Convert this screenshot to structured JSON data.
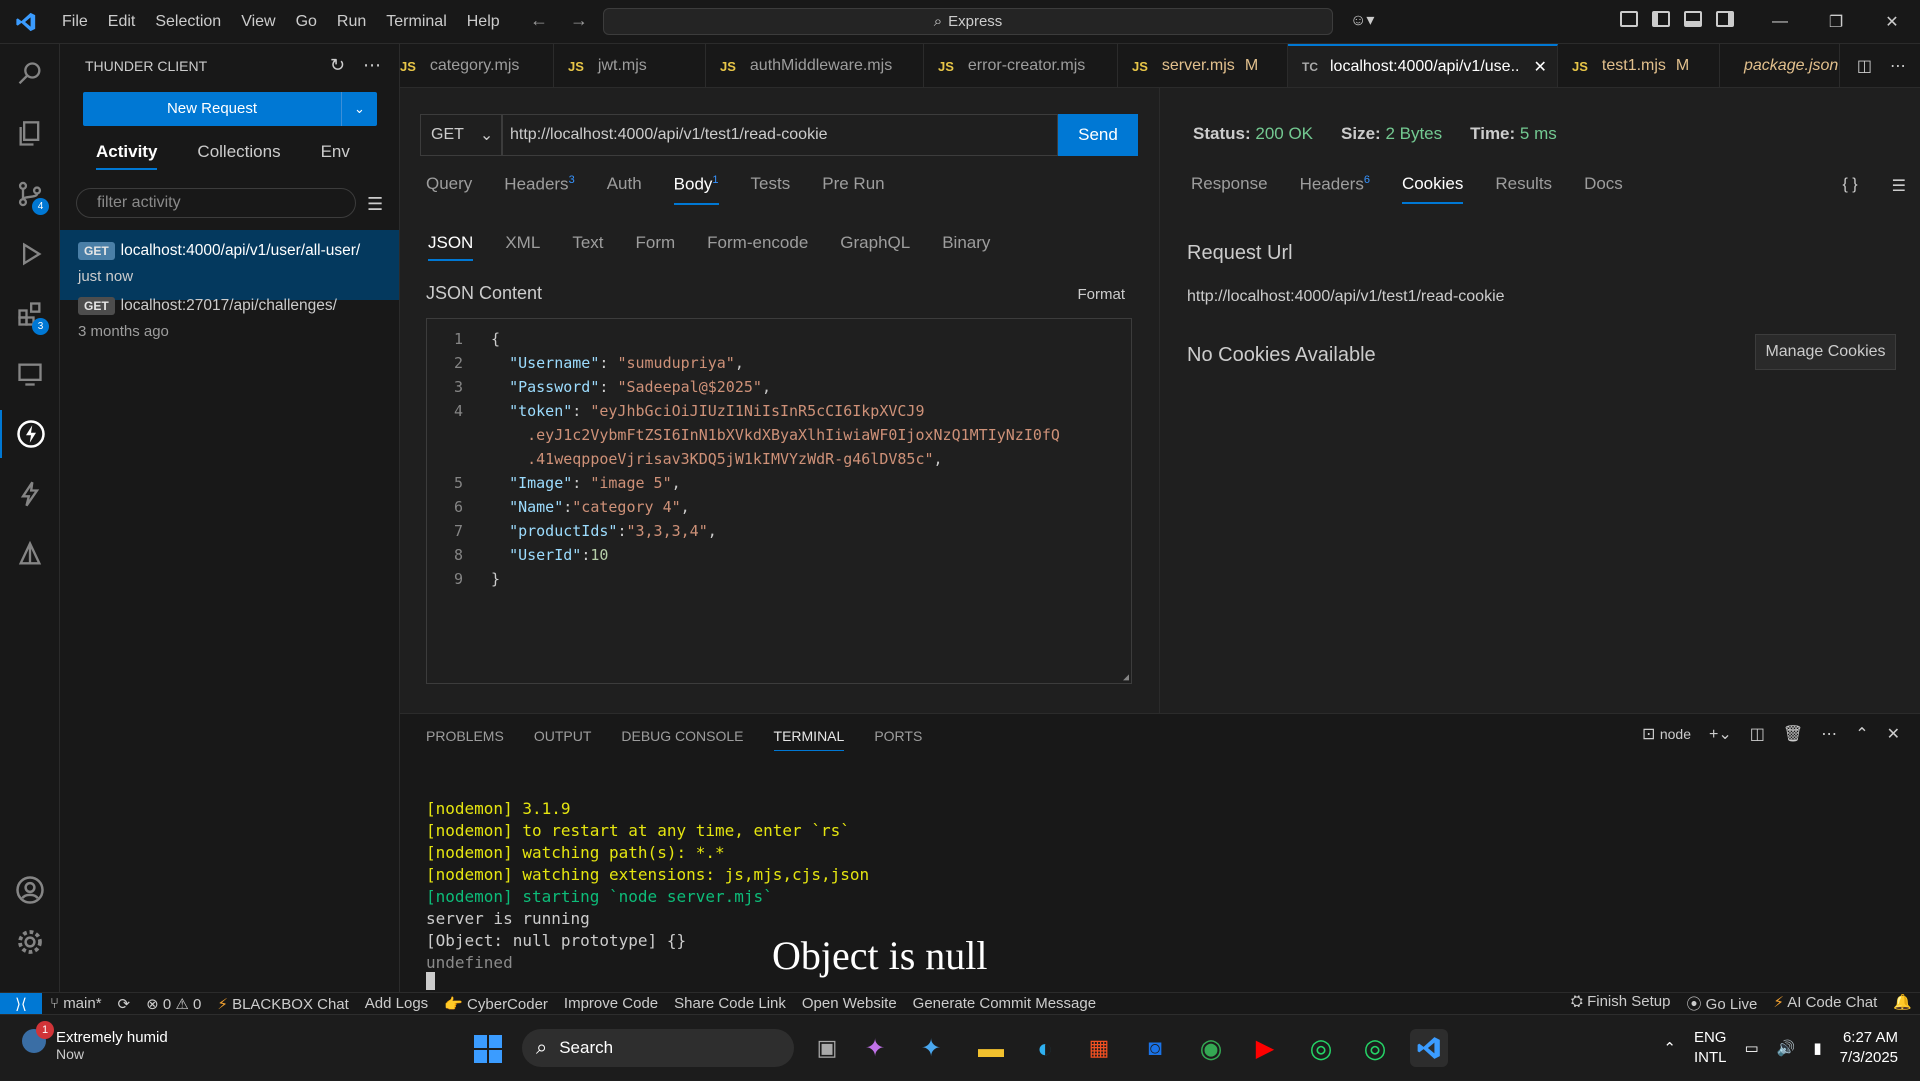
{
  "menu": [
    "File",
    "Edit",
    "Selection",
    "View",
    "Go",
    "Run",
    "Terminal",
    "Help"
  ],
  "command_center": "Express",
  "sidebar": {
    "title": "THUNDER CLIENT",
    "new_request": "New Request",
    "tabs": [
      "Activity",
      "Collections",
      "Env"
    ],
    "filter_placeholder": "filter activity",
    "items": [
      {
        "method": "GET",
        "url": "localhost:4000/api/v1/user/all-user/",
        "time": "just now"
      },
      {
        "method": "GET",
        "url": "localhost:27017/api/challenges/",
        "time": "3 months ago"
      }
    ]
  },
  "activity_badges": {
    "source_control": "4",
    "extensions": "3"
  },
  "tabs": [
    {
      "icon": "JS",
      "label": "category.mjs"
    },
    {
      "icon": "JS",
      "label": "jwt.mjs"
    },
    {
      "icon": "JS",
      "label": "authMiddleware.mjs"
    },
    {
      "icon": "JS",
      "label": "error-creator.mjs"
    },
    {
      "icon": "JS",
      "label": "server.mjs",
      "mod": "M"
    },
    {
      "icon": "TC",
      "label": "localhost:4000/api/v1/use..",
      "close": "✕"
    },
    {
      "icon": "JS",
      "label": "test1.mjs",
      "mod": "M"
    },
    {
      "icon": "npm",
      "label": "package.json"
    }
  ],
  "request": {
    "method": "GET",
    "url": "http://localhost:4000/api/v1/test1/read-cookie",
    "send": "Send",
    "tabs": [
      {
        "label": "Query"
      },
      {
        "label": "Headers",
        "count": "3"
      },
      {
        "label": "Auth"
      },
      {
        "label": "Body",
        "count": "1"
      },
      {
        "label": "Tests"
      },
      {
        "label": "Pre Run"
      }
    ],
    "body_tabs": [
      "JSON",
      "XML",
      "Text",
      "Form",
      "Form-encode",
      "GraphQL",
      "Binary"
    ],
    "json_label": "JSON Content",
    "format": "Format",
    "code": [
      {
        "n": "1",
        "segs": [
          [
            "p",
            "{"
          ]
        ]
      },
      {
        "n": "2",
        "segs": [
          [
            "p",
            "  "
          ],
          [
            "k",
            "\"Username\""
          ],
          [
            "p",
            ": "
          ],
          [
            "s",
            "\"sumudupriya\""
          ],
          [
            "p",
            ","
          ]
        ]
      },
      {
        "n": "3",
        "segs": [
          [
            "p",
            "  "
          ],
          [
            "k",
            "\"Password\""
          ],
          [
            "p",
            ": "
          ],
          [
            "s",
            "\"Sadeepal@$2025\""
          ],
          [
            "p",
            ","
          ]
        ]
      },
      {
        "n": "4",
        "segs": [
          [
            "p",
            "  "
          ],
          [
            "k",
            "\"token\""
          ],
          [
            "p",
            ": "
          ],
          [
            "s",
            "\"eyJhbGciOiJIUzI1NiIsInR5cCI6IkpXVCJ9"
          ]
        ]
      },
      {
        "n": "",
        "segs": [
          [
            "s",
            "    .eyJ1c2VybmFtZSI6InN1bXVkdXByaXlhIiwiaWF0IjoxNzQ1MTIyNzI0fQ"
          ]
        ]
      },
      {
        "n": "",
        "segs": [
          [
            "s",
            "    .41weqppoeVjrisav3KDQ5jW1kIMVYzWdR-g46lDV85c\""
          ],
          [
            "p",
            ","
          ]
        ]
      },
      {
        "n": "5",
        "segs": [
          [
            "p",
            "  "
          ],
          [
            "k",
            "\"Image\""
          ],
          [
            "p",
            ": "
          ],
          [
            "s",
            "\"image 5\""
          ],
          [
            "p",
            ","
          ]
        ]
      },
      {
        "n": "6",
        "segs": [
          [
            "p",
            "  "
          ],
          [
            "k",
            "\"Name\""
          ],
          [
            "p",
            ":"
          ],
          [
            "s",
            "\"category 4\""
          ],
          [
            "p",
            ","
          ]
        ]
      },
      {
        "n": "7",
        "segs": [
          [
            "p",
            "  "
          ],
          [
            "k",
            "\"productIds\""
          ],
          [
            "p",
            ":"
          ],
          [
            "s",
            "\"3,3,3,4\""
          ],
          [
            "p",
            ","
          ]
        ]
      },
      {
        "n": "8",
        "segs": [
          [
            "p",
            "  "
          ],
          [
            "k",
            "\"UserId\""
          ],
          [
            "p",
            ":"
          ],
          [
            "n",
            "10"
          ]
        ]
      },
      {
        "n": "9",
        "segs": [
          [
            "p",
            "}"
          ]
        ]
      }
    ]
  },
  "response": {
    "status_label": "Status:",
    "status_value": "200 OK",
    "size_label": "Size:",
    "size_value": "2 Bytes",
    "time_label": "Time:",
    "time_value": "5 ms",
    "tabs": [
      {
        "label": "Response"
      },
      {
        "label": "Headers",
        "count": "6"
      },
      {
        "label": "Cookies"
      },
      {
        "label": "Results"
      },
      {
        "label": "Docs"
      }
    ],
    "request_url_label": "Request Url",
    "request_url": "http://localhost:4000/api/v1/test1/read-cookie",
    "no_cookies": "No Cookies Available",
    "manage_cookies": "Manage Cookies"
  },
  "panel": {
    "tabs": [
      "PROBLEMS",
      "OUTPUT",
      "DEBUG CONSOLE",
      "TERMINAL",
      "PORTS"
    ],
    "terminal_name": "node",
    "lines": [
      {
        "c": "y",
        "t": "[nodemon] 3.1.9"
      },
      {
        "c": "y",
        "t": "[nodemon] to restart at any time, enter `rs`"
      },
      {
        "c": "y",
        "t": "[nodemon] watching path(s): *.*"
      },
      {
        "c": "y",
        "t": "[nodemon] watching extensions: js,mjs,cjs,json"
      },
      {
        "c": "g",
        "t": "[nodemon] starting `node server.mjs`"
      },
      {
        "c": "w",
        "t": "server is running"
      },
      {
        "c": "w",
        "t": "[Object: null prototype] {}"
      },
      {
        "c": "d",
        "t": "undefined"
      }
    ],
    "overlay": "Object is null"
  },
  "statusbar": {
    "branch": "main*",
    "errors": "0",
    "warnings": "0",
    "left_items": [
      "BLACKBOX Chat",
      "Add Logs",
      "CyberCoder",
      "Improve Code",
      "Share Code Link",
      "Open Website",
      "Generate Commit Message"
    ],
    "right_items": [
      "Finish Setup",
      "Go Live",
      "AI Code Chat"
    ]
  },
  "taskbar": {
    "weather_title": "Extremely humid",
    "weather_sub": "Now",
    "weather_badge": "1",
    "search": "Search",
    "lang1": "ENG",
    "lang2": "INTL",
    "time": "6:27 AM",
    "date": "7/3/2025"
  },
  "colors": {
    "accent": "#0078d4",
    "ok": "#73c991"
  }
}
